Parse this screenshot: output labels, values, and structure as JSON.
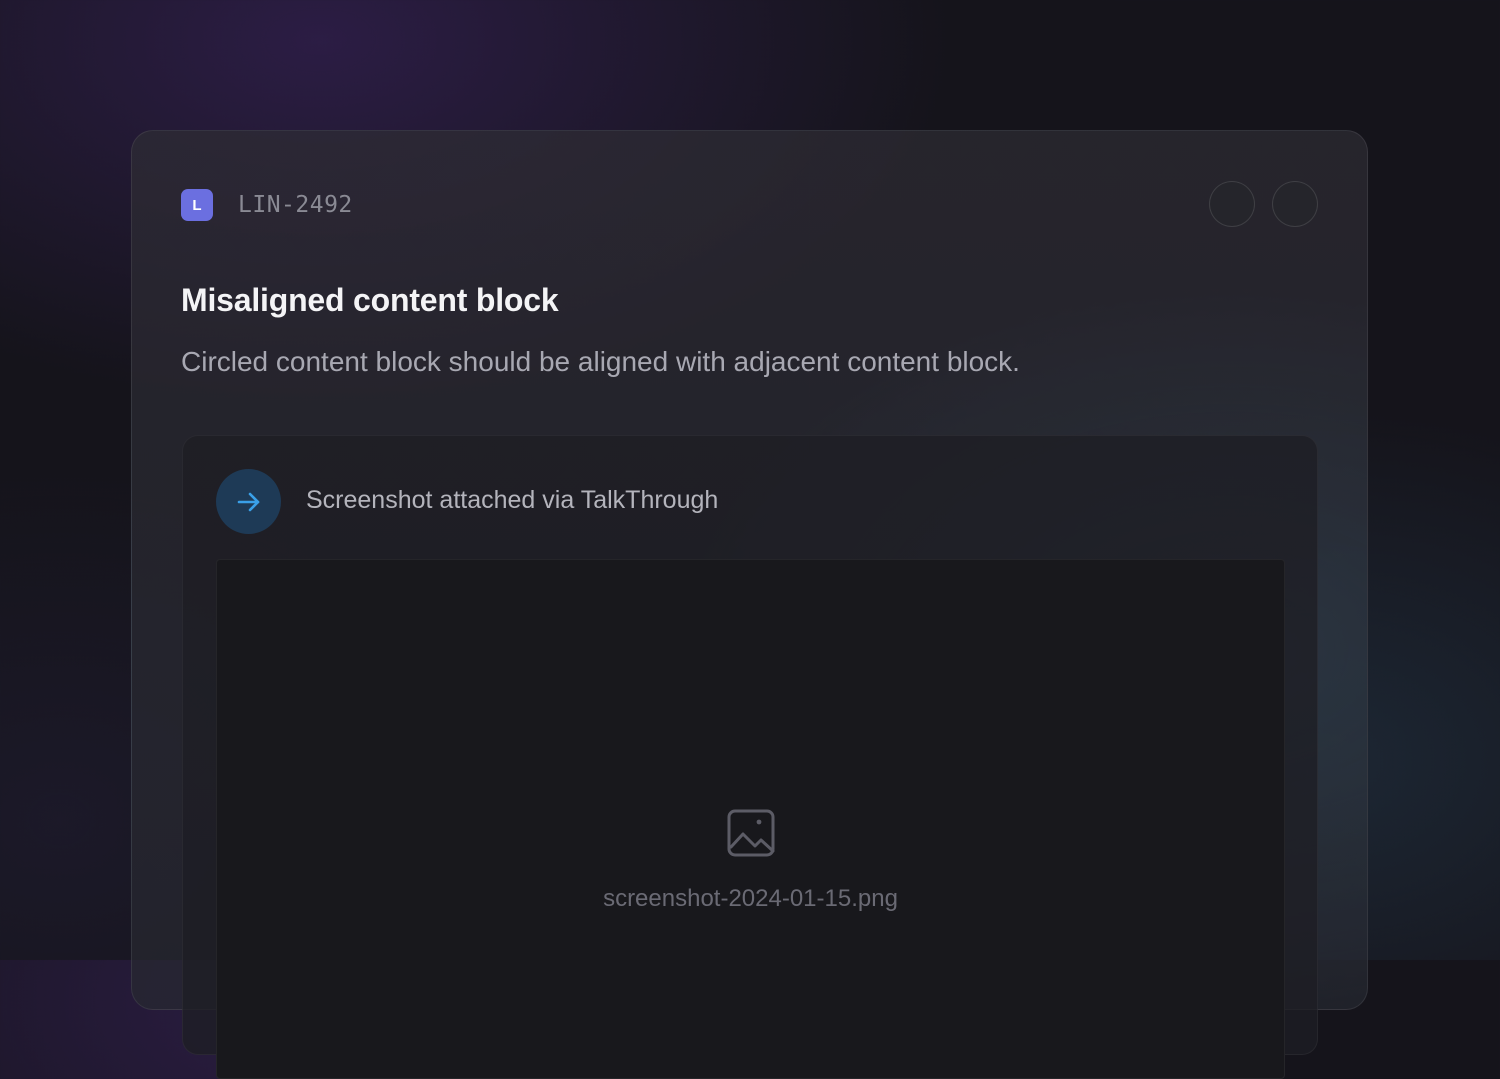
{
  "ticket": {
    "badge_letter": "L",
    "badge_color": "#6b6fe0",
    "id": "LIN-2492"
  },
  "window_controls": [
    "control-1",
    "control-2"
  ],
  "issue": {
    "title": "Misaligned content block",
    "description": "Circled content block should be aligned with adjacent content block."
  },
  "attachment": {
    "source_icon": "arrow-right-icon",
    "source_text": "Screenshot attached via TalkThrough",
    "accent_color": "#3aa0e8",
    "preview_icon": "image-icon",
    "filename": "screenshot-2024-01-15.png"
  }
}
